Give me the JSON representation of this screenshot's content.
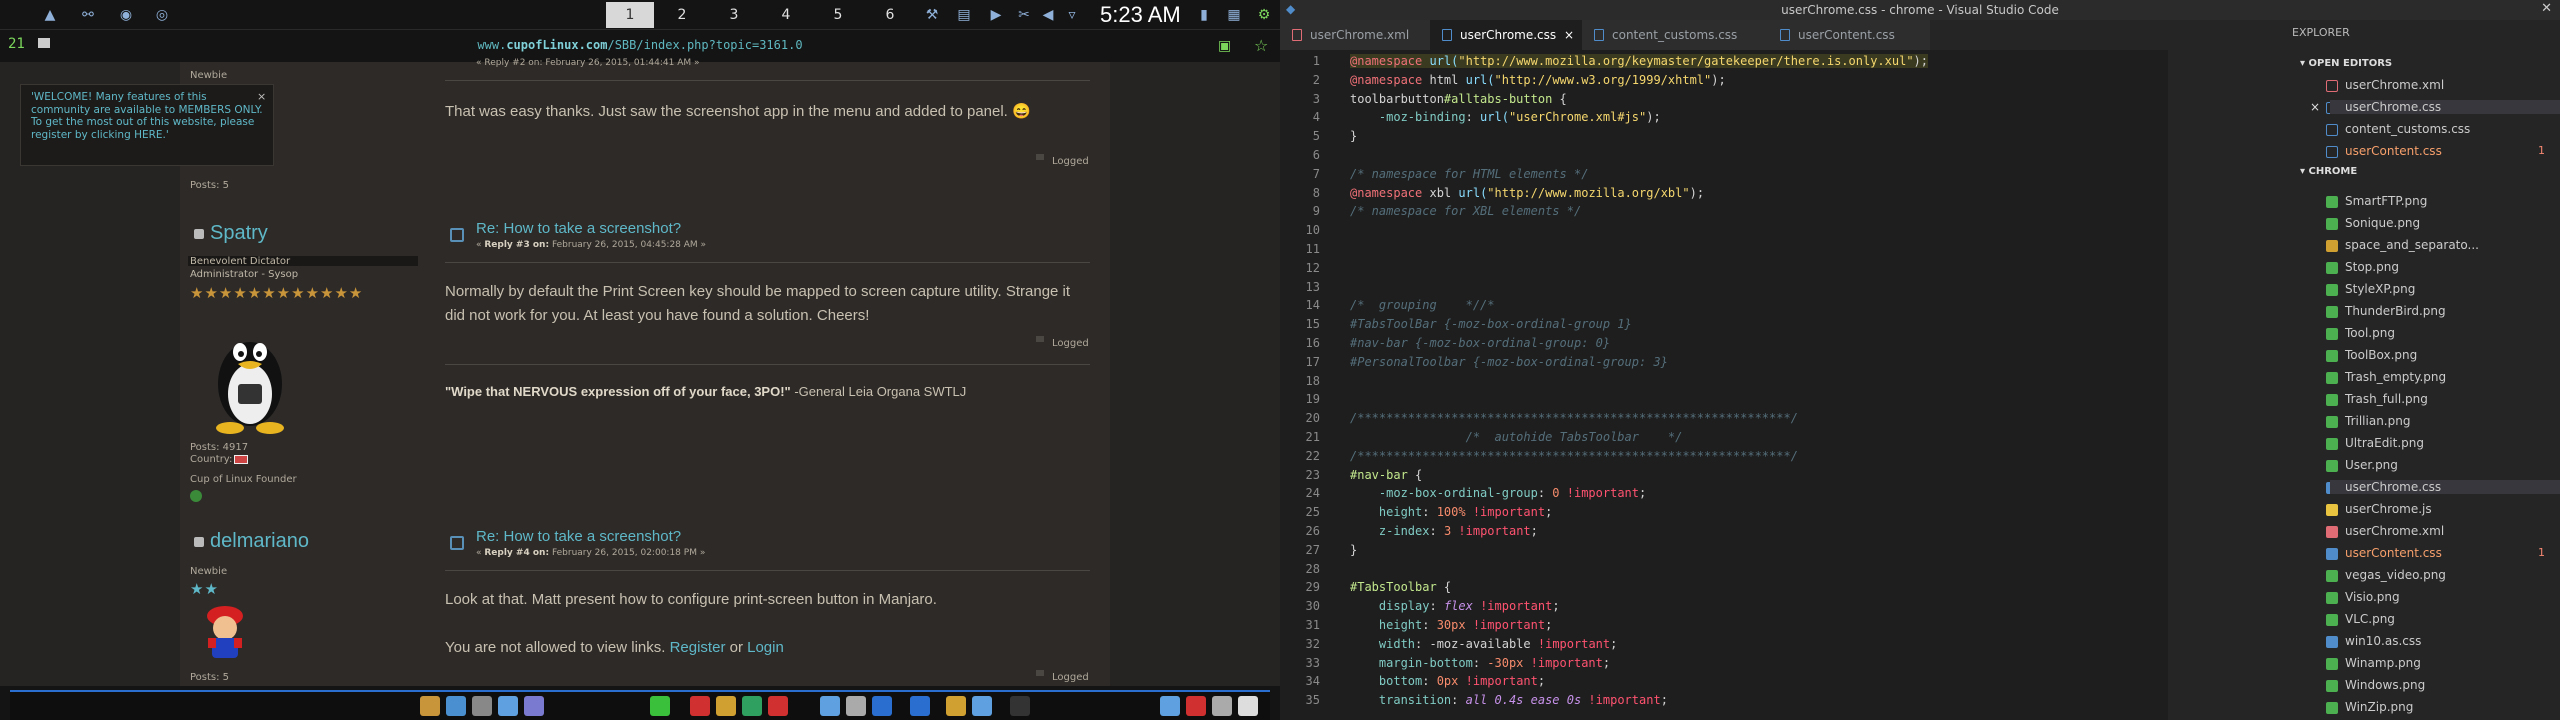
{
  "top_panel": {
    "workspaces": [
      "1",
      "2",
      "3",
      "4",
      "5",
      "6"
    ],
    "active_workspace": "1",
    "clock": "5:23 AM"
  },
  "browser": {
    "url_prefix": "www.",
    "url_domain": "cupofLinux.com",
    "url_path": "/SBB/index.php?topic=3161.0",
    "counter": "21",
    "welcome": "'WELCOME! Many features of this community are available to MEMBERS ONLY. To get the most out of this website, please register by clicking HERE.'",
    "welcome_close": "×",
    "top_meta": "Newbie",
    "top_reply": "« Reply #2 on: February 26, 2015, 01:44:41 AM »",
    "top_posts": "Posts: 5",
    "post2_body": "That was easy thanks. Just saw the screenshot app in the menu and added to panel. 😄",
    "logged": "Logged",
    "post3": {
      "user": "Spatry",
      "rank": "Benevolent Dictator",
      "role": "Administrator - Sysop",
      "stars": "★★★★★★★★★★★★",
      "title": "Re: How to take a screenshot?",
      "reply_label": "Reply #3 on:",
      "reply_date": "February 26, 2015, 04:45:28 AM »",
      "body": "Normally by default the Print Screen key should be mapped to screen capture utility. Strange it did not work for you. At least you have found a solution. Cheers!",
      "posts": "Posts: 4917",
      "country": "Country:",
      "founder": "Cup of Linux Founder",
      "sig_quote": "\"Wipe that NERVOUS expression off of your face, 3PO!\"",
      "sig_author": " -General Leia Organa SWTLJ"
    },
    "post4": {
      "user": "delmariano",
      "rank": "Newbie",
      "stars": "★★",
      "title": "Re: How to take a screenshot?",
      "reply_label": "Reply #4 on:",
      "reply_date": "February 26, 2015, 02:00:18 PM »",
      "body": "Look at that. Matt present how to configure print-screen button in Manjaro.",
      "view_pre": "You are not allowed to view links. ",
      "register": "Register",
      "view_or": " or ",
      "login": "Login",
      "posts": "Posts: 5"
    }
  },
  "vscode": {
    "title": "userChrome.css - chrome - Visual Studio Code",
    "tabs": [
      "userChrome.xml",
      "userChrome.css",
      "content_customs.css",
      "userContent.css"
    ],
    "active_tab": "userChrome.css",
    "tab_close": "×",
    "explorer_title": "EXPLORER",
    "open_editors_label": "OPEN EDITORS",
    "chrome_label": "CHROME",
    "open_editors": [
      "userChrome.xml",
      "userChrome.css",
      "content_customs.css",
      "userContent.css"
    ],
    "files": [
      "SmartFTP.png",
      "Sonique.png",
      "space_and_separato...",
      "Stop.png",
      "StyleXP.png",
      "ThunderBird.png",
      "Tool.png",
      "ToolBox.png",
      "Trash_empty.png",
      "Trash_full.png",
      "Trillian.png",
      "UltraEdit.png",
      "User.png",
      "userChrome.css",
      "userChrome.js",
      "userChrome.xml",
      "userContent.css",
      "vegas_video.png",
      "Visio.png",
      "VLC.png",
      "win10.as.css",
      "Winamp.png",
      "Windows.png",
      "WinZip.png"
    ],
    "badge": "1",
    "code": [
      {
        "n": "1",
        "t": [
          {
            "c": "c-at hl",
            "s": "@namespace "
          },
          {
            "c": "c-fn hl",
            "s": "url("
          },
          {
            "c": "c-str hl",
            "s": "\"http://www.mozilla.org/keymaster/gatekeeper/there.is.only.xul\""
          },
          {
            "c": "hl",
            "s": ");"
          }
        ]
      },
      {
        "n": "2",
        "t": [
          {
            "c": "c-at",
            "s": "@namespace "
          },
          {
            "c": "",
            "s": "html "
          },
          {
            "c": "c-fn",
            "s": "url("
          },
          {
            "c": "c-str",
            "s": "\"http://www.w3.org/1999/xhtml\""
          },
          {
            "c": "",
            "s": ");"
          }
        ]
      },
      {
        "n": "3",
        "t": [
          {
            "c": "",
            "s": "toolbarbutton"
          },
          {
            "c": "c-sel",
            "s": "#alltabs-button"
          },
          {
            "c": "",
            "s": " {"
          }
        ]
      },
      {
        "n": "4",
        "t": [
          {
            "c": "c-prop",
            "s": "    -moz-binding"
          },
          {
            "c": "",
            "s": ": "
          },
          {
            "c": "c-fn",
            "s": "url("
          },
          {
            "c": "c-str",
            "s": "\"userChrome.xml#js\""
          },
          {
            "c": "",
            "s": ");"
          }
        ]
      },
      {
        "n": "5",
        "t": [
          {
            "c": "",
            "s": "}"
          }
        ]
      },
      {
        "n": "6",
        "t": []
      },
      {
        "n": "7",
        "t": [
          {
            "c": "c-cmt",
            "s": "/* namespace for HTML elements */"
          }
        ]
      },
      {
        "n": "8",
        "t": [
          {
            "c": "c-at",
            "s": "@namespace "
          },
          {
            "c": "",
            "s": "xbl "
          },
          {
            "c": "c-fn",
            "s": "url("
          },
          {
            "c": "c-str",
            "s": "\"http://www.mozilla.org/xbl\""
          },
          {
            "c": "",
            "s": ");"
          }
        ]
      },
      {
        "n": "9",
        "t": [
          {
            "c": "c-cmt",
            "s": "/* namespace for XBL elements */"
          }
        ]
      },
      {
        "n": "10",
        "t": []
      },
      {
        "n": "11",
        "t": []
      },
      {
        "n": "12",
        "t": []
      },
      {
        "n": "13",
        "t": []
      },
      {
        "n": "14",
        "t": [
          {
            "c": "c-cmt",
            "s": "/*  grouping    *//*"
          }
        ]
      },
      {
        "n": "15",
        "t": [
          {
            "c": "c-cmt",
            "s": "#TabsToolBar {-moz-box-ordinal-group 1}"
          }
        ]
      },
      {
        "n": "16",
        "t": [
          {
            "c": "c-cmt",
            "s": "#nav-bar {-moz-box-ordinal-group: 0}"
          }
        ]
      },
      {
        "n": "17",
        "t": [
          {
            "c": "c-cmt",
            "s": "#PersonalToolbar {-moz-box-ordinal-group: 3}"
          }
        ]
      },
      {
        "n": "18",
        "t": []
      },
      {
        "n": "19",
        "t": []
      },
      {
        "n": "20",
        "t": [
          {
            "c": "c-cmt",
            "s": "/************************************************************/"
          }
        ]
      },
      {
        "n": "21",
        "t": [
          {
            "c": "c-cmt",
            "s": "                /*  autohide TabsToolbar    */"
          }
        ]
      },
      {
        "n": "22",
        "t": [
          {
            "c": "c-cmt",
            "s": "/************************************************************/"
          }
        ]
      },
      {
        "n": "23",
        "t": [
          {
            "c": "c-sel",
            "s": "#nav-bar"
          },
          {
            "c": "",
            "s": " {"
          }
        ]
      },
      {
        "n": "24",
        "t": [
          {
            "c": "c-prop",
            "s": "    -moz-box-ordinal-group"
          },
          {
            "c": "",
            "s": ": "
          },
          {
            "c": "c-num",
            "s": "0"
          },
          {
            "c": "c-imp",
            "s": " !important"
          },
          {
            "c": "",
            "s": ";"
          }
        ]
      },
      {
        "n": "25",
        "t": [
          {
            "c": "c-prop",
            "s": "    height"
          },
          {
            "c": "",
            "s": ": "
          },
          {
            "c": "c-num",
            "s": "100%"
          },
          {
            "c": "c-imp",
            "s": " !important"
          },
          {
            "c": "",
            "s": ";"
          }
        ]
      },
      {
        "n": "26",
        "t": [
          {
            "c": "c-prop",
            "s": "    z-index"
          },
          {
            "c": "",
            "s": ": "
          },
          {
            "c": "c-num",
            "s": "3"
          },
          {
            "c": "c-imp",
            "s": " !important"
          },
          {
            "c": "",
            "s": ";"
          }
        ]
      },
      {
        "n": "27",
        "t": [
          {
            "c": "",
            "s": "}"
          }
        ]
      },
      {
        "n": "28",
        "t": []
      },
      {
        "n": "29",
        "t": [
          {
            "c": "c-sel",
            "s": "#TabsToolbar"
          },
          {
            "c": "",
            "s": " {"
          }
        ]
      },
      {
        "n": "30",
        "t": [
          {
            "c": "c-prop",
            "s": "    display"
          },
          {
            "c": "",
            "s": ": "
          },
          {
            "c": "c-kw",
            "s": "flex"
          },
          {
            "c": "c-imp",
            "s": " !important"
          },
          {
            "c": "",
            "s": ";"
          }
        ]
      },
      {
        "n": "31",
        "t": [
          {
            "c": "c-prop",
            "s": "    height"
          },
          {
            "c": "",
            "s": ": "
          },
          {
            "c": "c-num",
            "s": "30px"
          },
          {
            "c": "c-imp",
            "s": " !important"
          },
          {
            "c": "",
            "s": ";"
          }
        ]
      },
      {
        "n": "32",
        "t": [
          {
            "c": "c-prop",
            "s": "    width"
          },
          {
            "c": "",
            "s": ": "
          },
          {
            "c": "",
            "s": "-moz-available"
          },
          {
            "c": "c-imp",
            "s": " !important"
          },
          {
            "c": "",
            "s": ";"
          }
        ]
      },
      {
        "n": "33",
        "t": [
          {
            "c": "c-prop",
            "s": "    margin-bottom"
          },
          {
            "c": "",
            "s": ": "
          },
          {
            "c": "c-num",
            "s": "-30px"
          },
          {
            "c": "c-imp",
            "s": " !important"
          },
          {
            "c": "",
            "s": ";"
          }
        ]
      },
      {
        "n": "34",
        "t": [
          {
            "c": "c-prop",
            "s": "    bottom"
          },
          {
            "c": "",
            "s": ": "
          },
          {
            "c": "c-num",
            "s": "0px"
          },
          {
            "c": "c-imp",
            "s": " !important"
          },
          {
            "c": "",
            "s": ";"
          }
        ]
      },
      {
        "n": "35",
        "t": [
          {
            "c": "c-prop",
            "s": "    transition"
          },
          {
            "c": "",
            "s": ": "
          },
          {
            "c": "c-kw",
            "s": "all 0.4s ease 0s"
          },
          {
            "c": "c-imp",
            "s": " !important"
          },
          {
            "c": "",
            "s": ";"
          }
        ]
      }
    ]
  }
}
